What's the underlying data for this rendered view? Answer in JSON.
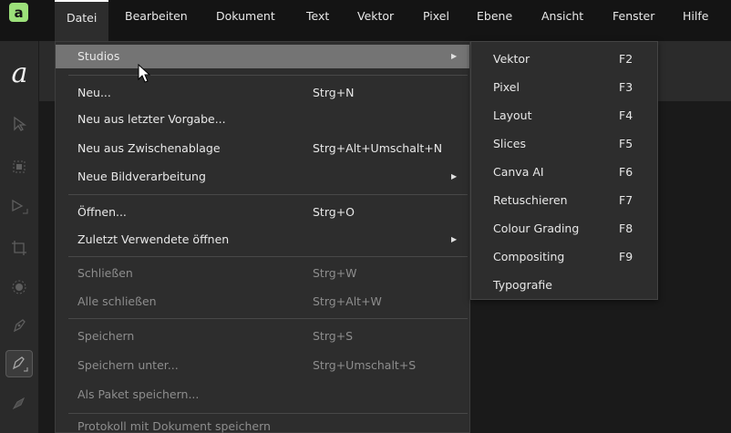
{
  "menubar": {
    "logo_letter": "a",
    "items": [
      "Datei",
      "Bearbeiten",
      "Dokument",
      "Text",
      "Vektor",
      "Pixel",
      "Ebene",
      "Ansicht",
      "Fenster",
      "Hilfe"
    ]
  },
  "toolbar": {
    "logo_letter": "a"
  },
  "file_menu": {
    "items": [
      {
        "label": "Studios",
        "shortcut": "",
        "submenu": true
      },
      {
        "label": "Neu...",
        "shortcut": "Strg+N"
      },
      {
        "label": "Neu aus letzter Vorgabe...",
        "shortcut": ""
      },
      {
        "label": "Neu aus Zwischenablage",
        "shortcut": "Strg+Alt+Umschalt+N"
      },
      {
        "label": "Neue Bildverarbeitung",
        "shortcut": "",
        "submenu": true
      },
      {
        "label": "Öffnen...",
        "shortcut": "Strg+O"
      },
      {
        "label": "Zuletzt Verwendete öffnen",
        "shortcut": "",
        "submenu": true
      },
      {
        "label": "Schließen",
        "shortcut": "Strg+W",
        "disabled": true
      },
      {
        "label": "Alle schließen",
        "shortcut": "Strg+Alt+W",
        "disabled": true
      },
      {
        "label": "Speichern",
        "shortcut": "Strg+S",
        "disabled": true
      },
      {
        "label": "Speichern unter...",
        "shortcut": "Strg+Umschalt+S",
        "disabled": true
      },
      {
        "label": "Als Paket speichern...",
        "shortcut": "",
        "disabled": true
      },
      {
        "label": "Protokoll mit Dokument speichern",
        "shortcut": "",
        "disabled": true
      }
    ],
    "submenu_arrow": "▶"
  },
  "studios_submenu": {
    "items": [
      {
        "label": "Vektor",
        "shortcut": "F2"
      },
      {
        "label": "Pixel",
        "shortcut": "F3"
      },
      {
        "label": "Layout",
        "shortcut": "F4"
      },
      {
        "label": "Slices",
        "shortcut": "F5"
      },
      {
        "label": "Canva AI",
        "shortcut": "F6"
      },
      {
        "label": "Retuschieren",
        "shortcut": "F7"
      },
      {
        "label": "Colour Grading",
        "shortcut": "F8"
      },
      {
        "label": "Compositing",
        "shortcut": "F9"
      },
      {
        "label": "Typografie",
        "shortcut": ""
      }
    ]
  },
  "colors": {
    "accent_logo": "#9ce07a",
    "highlight": "#747474",
    "menu_bg": "#2d2d2d"
  }
}
